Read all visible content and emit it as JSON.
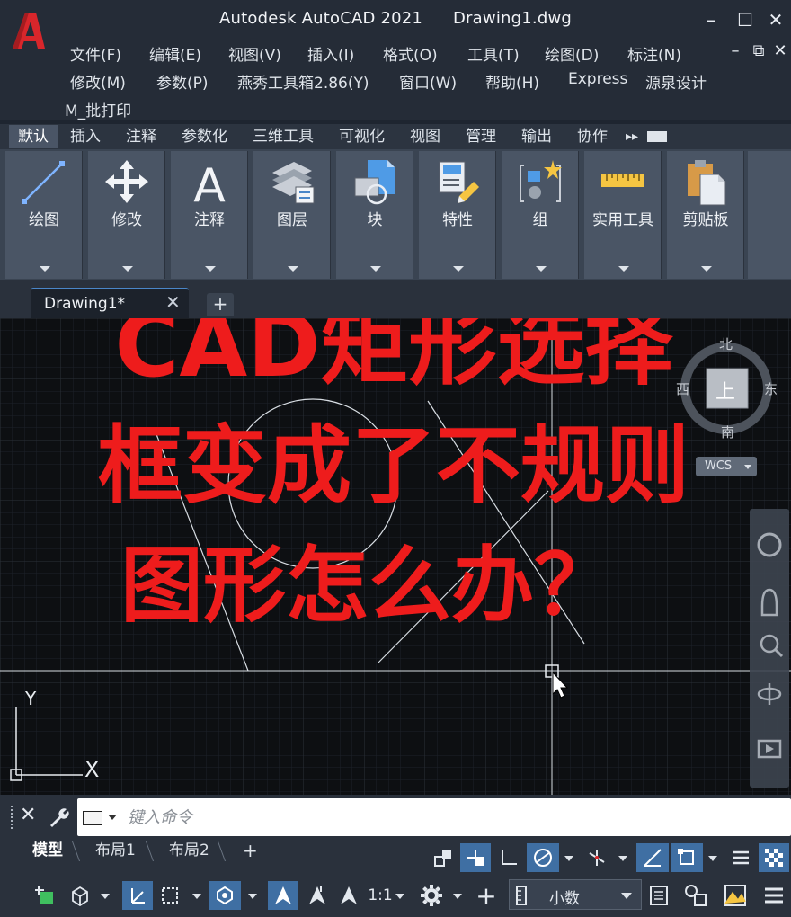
{
  "window": {
    "app_name": "Autodesk AutoCAD 2021",
    "file_name": "Drawing1.dwg",
    "minimize_glyph": "–",
    "maximize_glyph": "☐",
    "close_glyph": "✕",
    "doc_restore_glyph": "⧉",
    "doc_close_glyph": "✕",
    "doc_min_glyph": "–"
  },
  "menu": {
    "row1": [
      "文件(F)",
      "编辑(E)",
      "视图(V)",
      "插入(I)",
      "格式(O)",
      "工具(T)",
      "绘图(D)",
      "标注(N)"
    ],
    "row2": [
      "修改(M)",
      "参数(P)",
      "燕秀工具箱2.86(Y)",
      "窗口(W)",
      "帮助(H)",
      "Express",
      "源泉设计"
    ],
    "row3": [
      "M_批打印"
    ]
  },
  "ribbon_tabs": [
    "默认",
    "插入",
    "注释",
    "参数化",
    "三维工具",
    "可视化",
    "视图",
    "管理",
    "输出",
    "协作"
  ],
  "ribbon_tabs_more": "▸▸",
  "ribbon_panels": [
    {
      "label": "绘图",
      "icon": "line-draw-icon"
    },
    {
      "label": "修改",
      "icon": "move-arrows-icon"
    },
    {
      "label": "注释",
      "icon": "text-a-icon"
    },
    {
      "label": "图层",
      "icon": "layers-icon"
    },
    {
      "label": "块",
      "icon": "block-icon"
    },
    {
      "label": "特性",
      "icon": "properties-icon"
    },
    {
      "label": "组",
      "icon": "group-icon"
    },
    {
      "label": "实用工具",
      "icon": "ruler-icon"
    },
    {
      "label": "剪贴板",
      "icon": "clipboard-icon"
    }
  ],
  "file_tab": {
    "name": "Drawing1*",
    "close": "✕",
    "add": "+"
  },
  "overlay": {
    "line1": "CAD矩形选择",
    "line2": "框变成了不规则",
    "line3": "图形怎么办？",
    "color": "#ee1c1c"
  },
  "viewcube": {
    "north": "北",
    "south": "南",
    "east": "东",
    "west": "西",
    "face": "上",
    "wcs": "WCS"
  },
  "ucs": {
    "y_label": "Y",
    "x_label": "X"
  },
  "command": {
    "placeholder": "键入命令",
    "close": "✕",
    "wrench": "🔧"
  },
  "layout_tabs": {
    "model": "模型",
    "layout1": "布局1",
    "layout2": "布局2",
    "add": "+"
  },
  "status": {
    "scale": "1:1",
    "units": "小数",
    "plus": "+"
  }
}
